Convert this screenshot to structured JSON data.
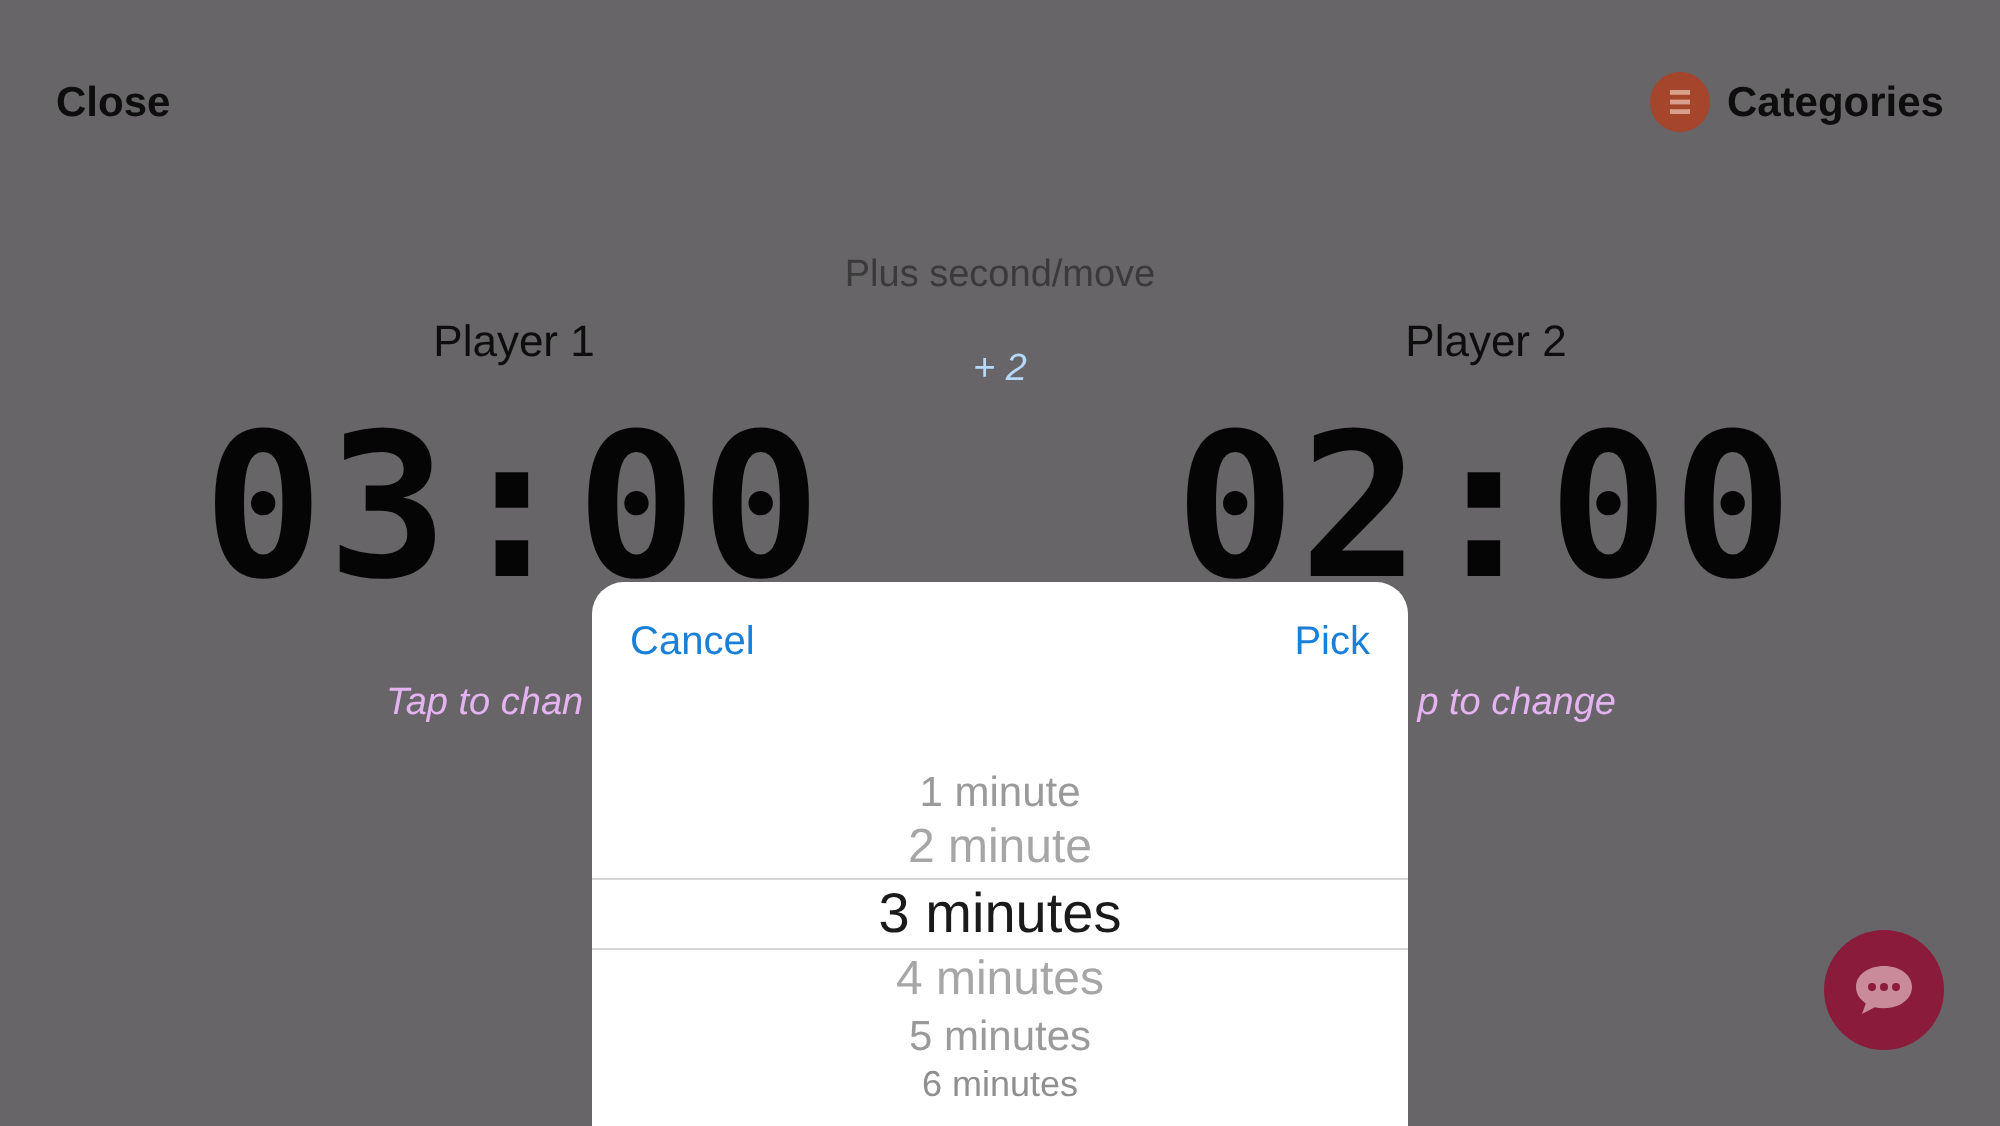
{
  "header": {
    "close": "Close",
    "categories": "Categories"
  },
  "increment": {
    "label": "Plus second/move",
    "value": "+ 2"
  },
  "players": [
    {
      "name": "Player 1",
      "time": "03:00",
      "hint": "Tap to chan"
    },
    {
      "name": "Player 2",
      "time": "02:00",
      "hint": "p to change"
    }
  ],
  "picker": {
    "cancel": "Cancel",
    "confirm": "Pick",
    "options": [
      {
        "label": "1 minute",
        "selected": false
      },
      {
        "label": "2 minute",
        "selected": false
      },
      {
        "label": "3 minutes",
        "selected": true
      },
      {
        "label": "4 minutes",
        "selected": false
      },
      {
        "label": "5 minutes",
        "selected": false
      },
      {
        "label": "6 minutes",
        "selected": false
      }
    ]
  }
}
